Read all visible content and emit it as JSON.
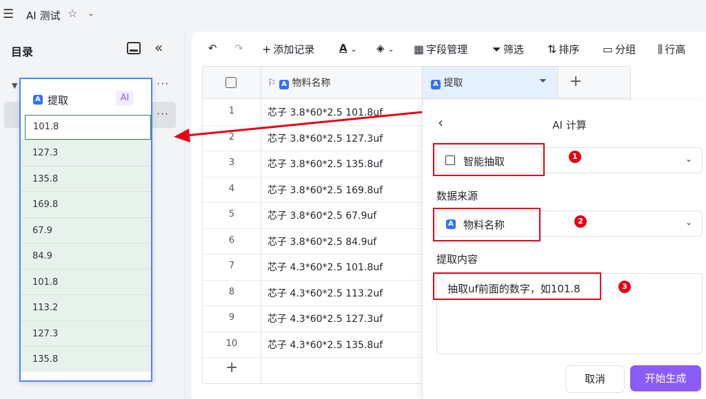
{
  "app": {
    "title": "AI 测试",
    "menu_icon": "hamburger-icon",
    "star_icon": "star-icon",
    "chevron_icon": "chevron-down-icon"
  },
  "sidebar": {
    "heading": "目录"
  },
  "popup": {
    "field_name": "提取",
    "ai_tag": "AI",
    "values": [
      "101.8",
      "127.3",
      "135.8",
      "169.8",
      "67.9",
      "84.9",
      "101.8",
      "113.2",
      "127.3",
      "135.8"
    ]
  },
  "toolbar": {
    "add_record": "添加记录",
    "field_manage": "字段管理",
    "filter": "筛选",
    "sort": "排序",
    "group": "分组",
    "row_height": "行高",
    "text_color_icon": "A"
  },
  "grid": {
    "col_name": "物料名称",
    "col_extract": "提取",
    "rows": [
      {
        "num": "1",
        "name": "芯子 3.8*60*2.5 101.8uf"
      },
      {
        "num": "2",
        "name": "芯子 3.8*60*2.5 127.3uf"
      },
      {
        "num": "3",
        "name": "芯子 3.8*60*2.5 135.8uf"
      },
      {
        "num": "4",
        "name": "芯子 3.8*60*2.5 169.8uf"
      },
      {
        "num": "5",
        "name": "芯子 3.8*60*2.5 67.9uf"
      },
      {
        "num": "6",
        "name": "芯子 3.8*60*2.5 84.9uf"
      },
      {
        "num": "7",
        "name": "芯子 4.3*60*2.5 101.8uf"
      },
      {
        "num": "8",
        "name": "芯子 4.3*60*2.5 113.2uf"
      },
      {
        "num": "9",
        "name": "芯子 4.3*60*2.5 127.3uf"
      },
      {
        "num": "10",
        "name": "芯子 4.3*60*2.5 135.8uf"
      }
    ]
  },
  "panel": {
    "title": "AI 计算",
    "mode_value": "智能抽取",
    "source_label": "数据来源",
    "source_value": "物料名称",
    "content_label": "提取内容",
    "content_value": "抽取uf前面的数字，如101.8",
    "cancel": "取消",
    "start": "开始生成",
    "markers": [
      "1",
      "2",
      "3"
    ]
  },
  "colors": {
    "accent": "#8b5cf6",
    "blue": "#3370ff",
    "annotation_red": "#e60012",
    "cell_green": "#e8f2ed"
  }
}
